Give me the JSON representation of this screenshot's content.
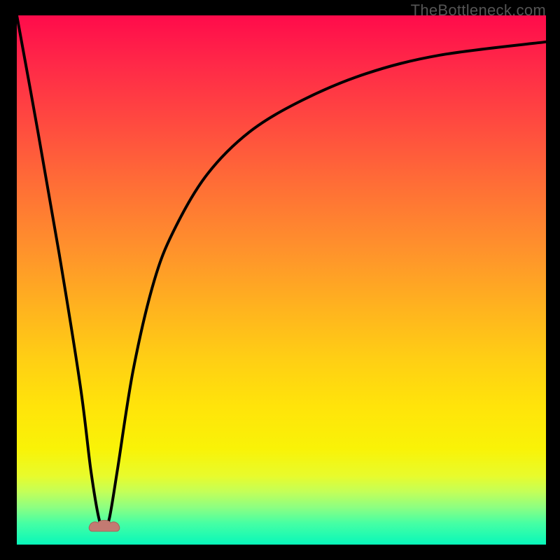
{
  "watermark": "TheBottleneck.com",
  "chart_data": {
    "type": "line",
    "title": "",
    "xlabel": "",
    "ylabel": "",
    "xlim": [
      0,
      100
    ],
    "ylim": [
      0,
      100
    ],
    "grid": false,
    "legend": null,
    "series": [
      {
        "name": "bottleneck-curve",
        "x": [
          0,
          4,
          8,
          12,
          14,
          15.5,
          16.5,
          17.5,
          19,
          22,
          26,
          30,
          36,
          44,
          54,
          66,
          80,
          100
        ],
        "y": [
          100,
          78,
          55,
          30,
          14,
          5,
          3,
          5,
          14,
          33,
          50,
          60,
          70,
          78,
          84,
          89,
          92.5,
          95
        ]
      }
    ],
    "annotations": [
      {
        "name": "valley-marker",
        "x": 16.5,
        "y": 3,
        "color": "#c37a72"
      }
    ],
    "background_gradient": {
      "type": "vertical-heat",
      "top": "#ff0b4b",
      "mid": "#ffe40a",
      "bottom": "#08f7ba"
    }
  }
}
